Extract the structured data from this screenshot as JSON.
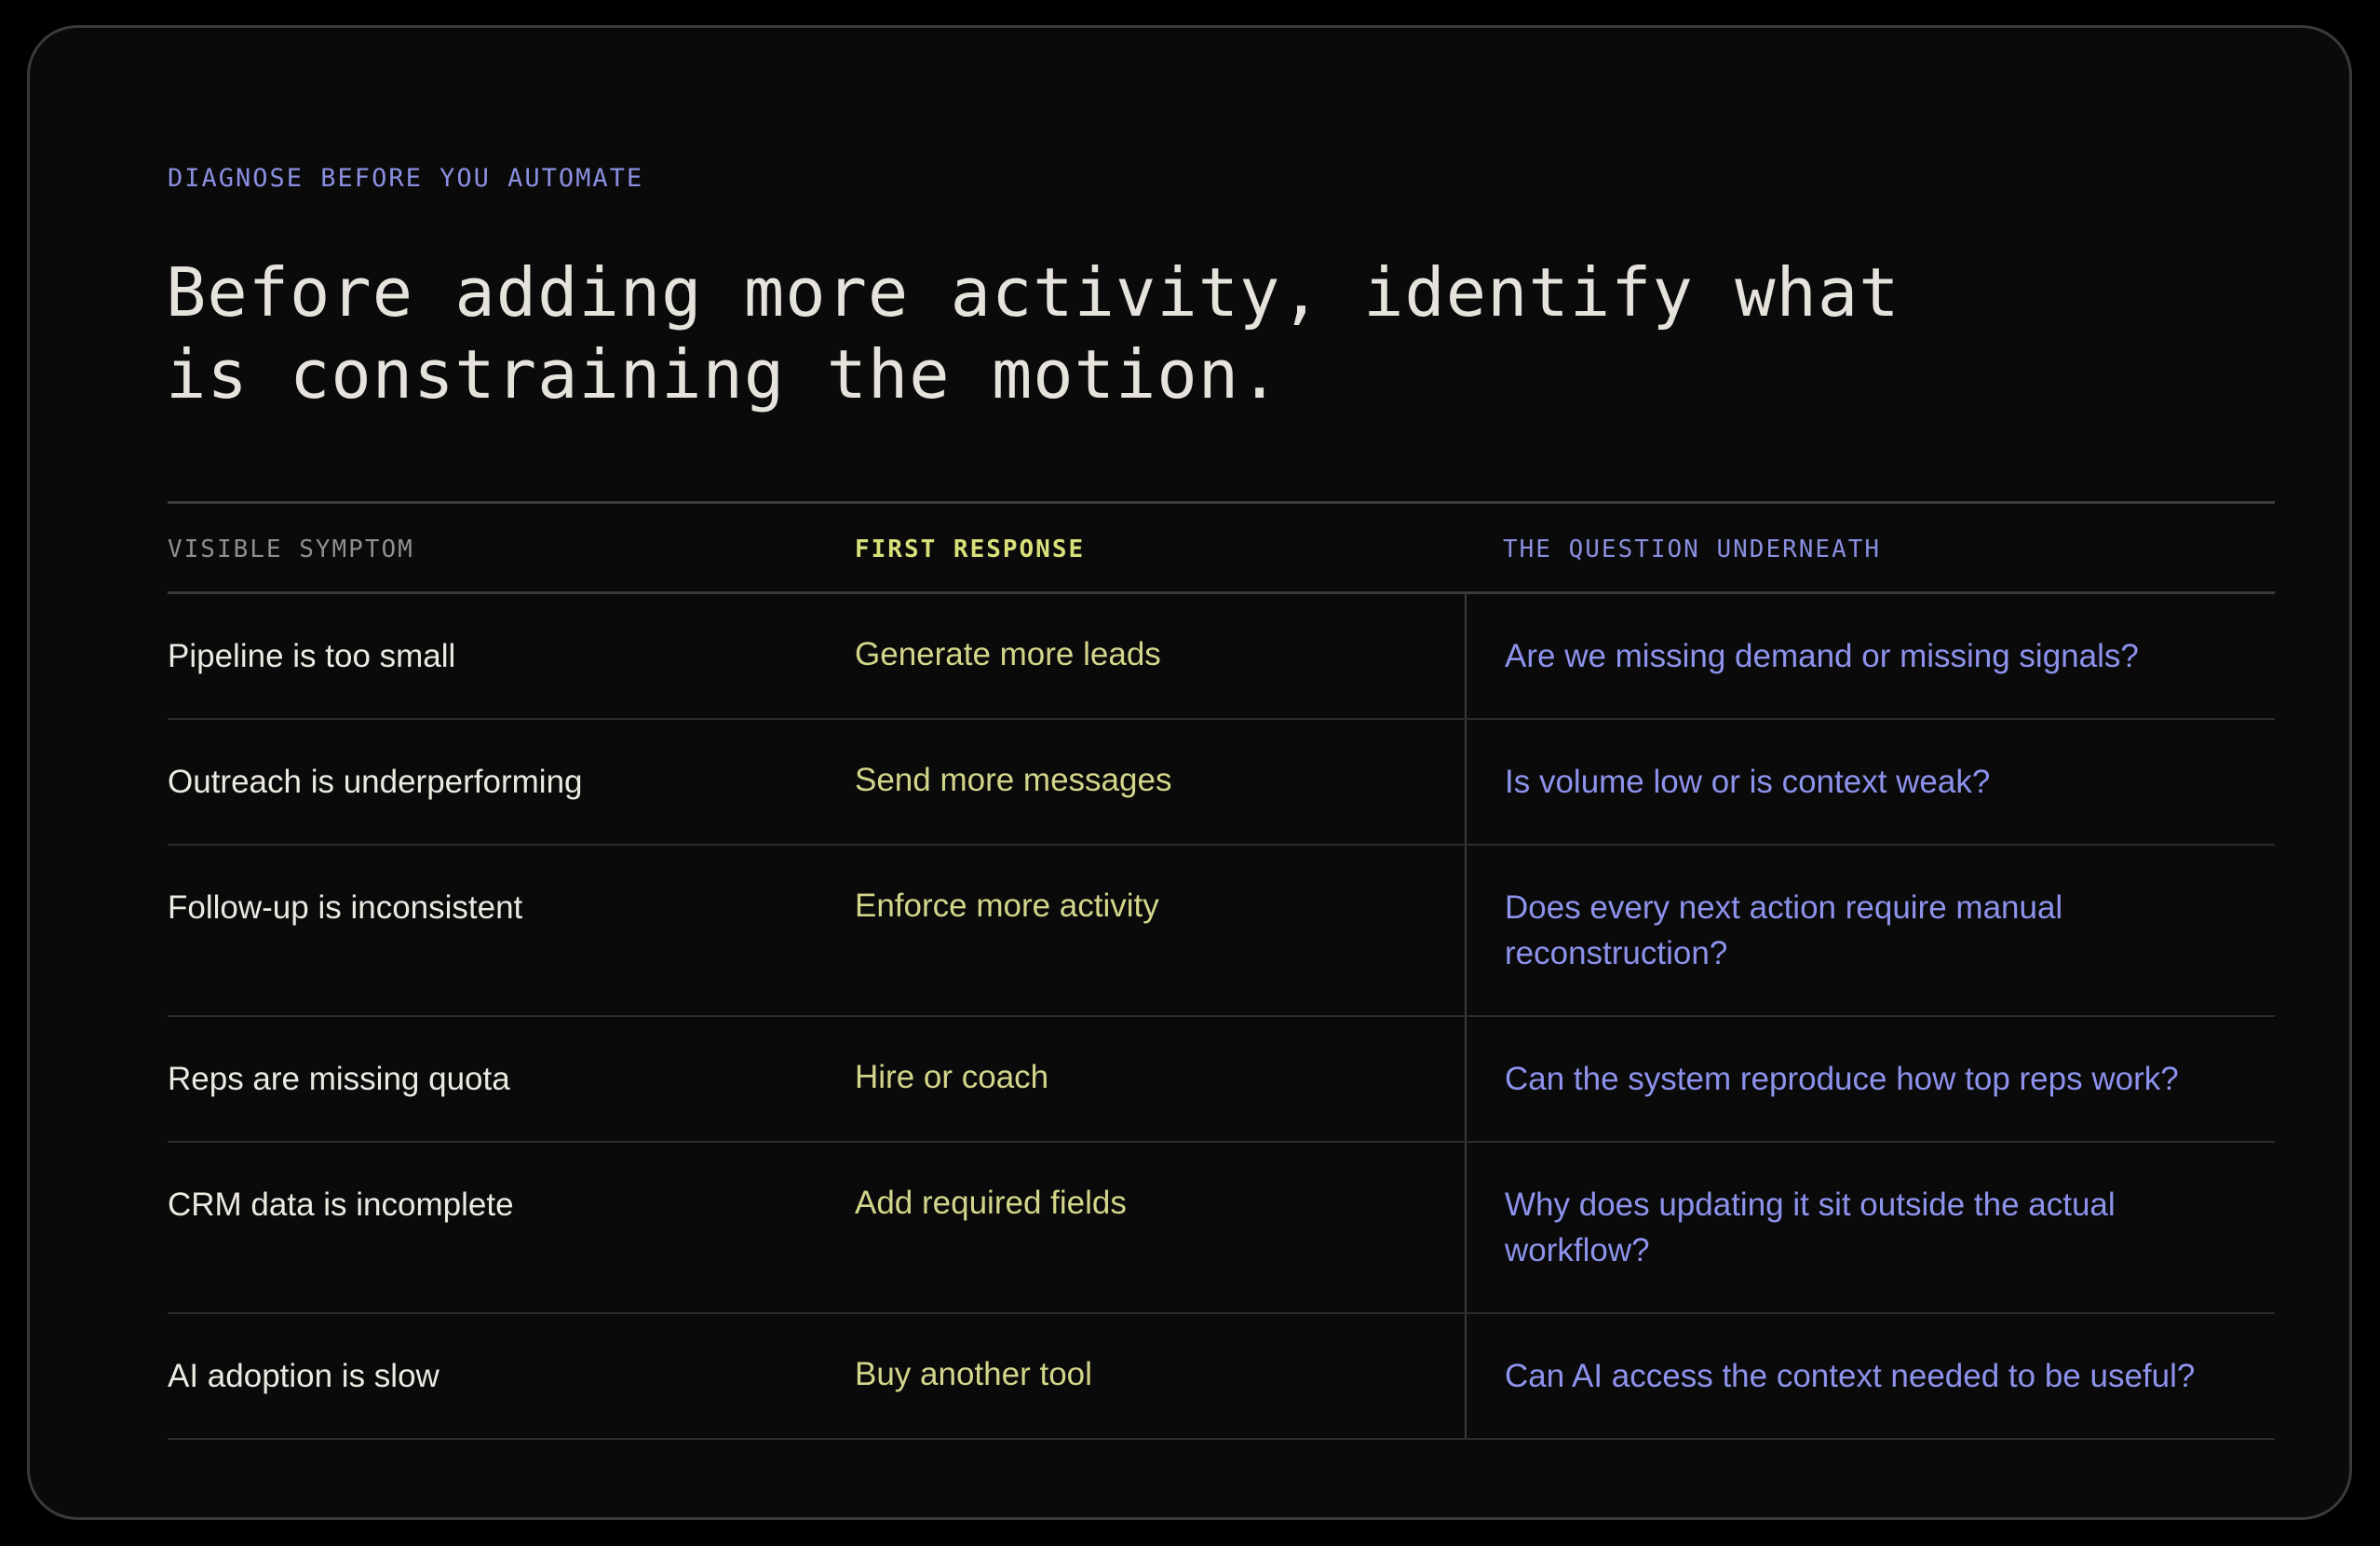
{
  "eyebrow": "DIAGNOSE BEFORE YOU AUTOMATE",
  "headline": {
    "line1": "Before adding more activity, identify what",
    "line2": "is constraining the motion."
  },
  "table": {
    "headers": {
      "symptom": "VISIBLE SYMPTOM",
      "response": "FIRST RESPONSE",
      "question": "THE QUESTION UNDERNEATH"
    },
    "rows": [
      {
        "symptom": "Pipeline is too small",
        "response": "Generate more leads",
        "question": "Are we missing demand or missing signals?"
      },
      {
        "symptom": "Outreach is underperforming",
        "response": "Send more messages",
        "question": "Is volume low or is context weak?"
      },
      {
        "symptom": "Follow-up is inconsistent",
        "response": "Enforce more activity",
        "question": "Does every next action require manual reconstruction?"
      },
      {
        "symptom": "Reps are missing quota",
        "response": "Hire or coach",
        "question": "Can the system reproduce how top reps work?"
      },
      {
        "symptom": "CRM data is incomplete",
        "response": "Add required fields",
        "question": "Why does updating it sit outside the actual workflow?"
      },
      {
        "symptom": "AI adoption is slow",
        "response": "Buy another tool",
        "question": "Can AI access the context needed to be useful?"
      }
    ]
  },
  "colors": {
    "background": "#0a0a0a",
    "headline": "#e6e3dc",
    "accent_yellow": "#d3d68a",
    "accent_blue": "#8d92ec",
    "muted": "#8f8f8f"
  }
}
